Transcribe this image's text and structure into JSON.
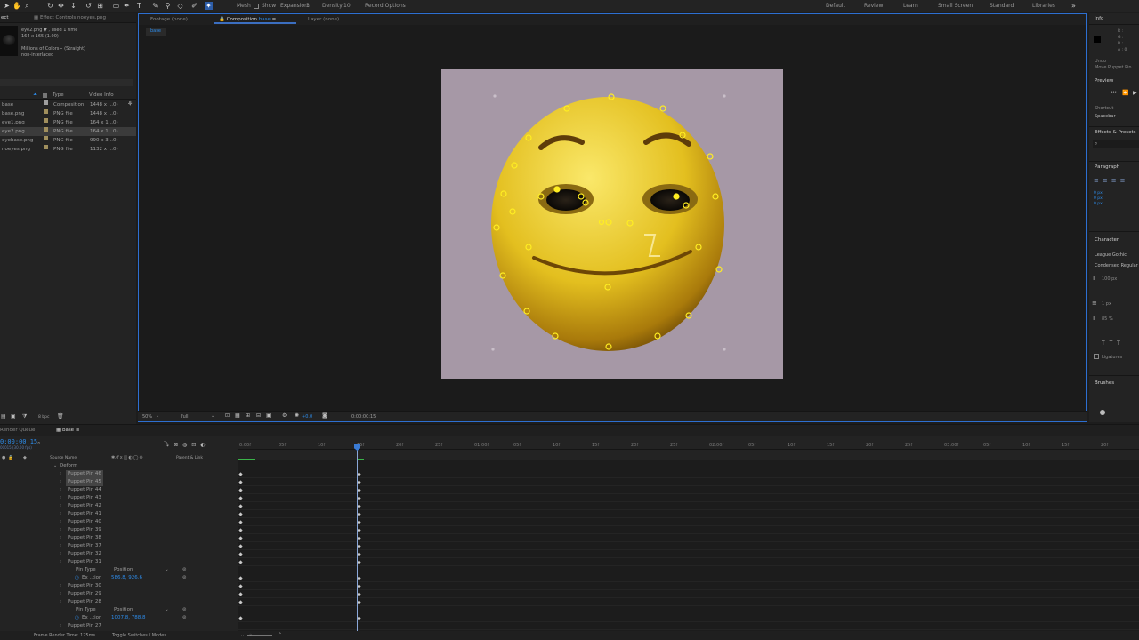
{
  "toolbar": {
    "mesh_label": "Mesh",
    "show_label": "Show",
    "expansion_label": "Expansion:",
    "expansion_value": "3",
    "density_label": "Density:",
    "density_value": "10",
    "record_options": "Record Options",
    "workspaces": [
      "Default",
      "Review",
      "Learn",
      "Small Screen",
      "Standard",
      "Libraries"
    ]
  },
  "project": {
    "tab_project": "ect",
    "tab_effect_controls": "Effect Controls noeyes.png",
    "preview_name": "eye2.png ▼ , used 1 time",
    "preview_dims": "164 x 165 (1.00)",
    "preview_color": "Millions of Colors+ (Straight)",
    "preview_interlace": "non-interlaced",
    "col_type": "Type",
    "col_info": "Video Info",
    "items": [
      {
        "name": "base",
        "type": "Composition",
        "info": "1448 x ...0)",
        "color": "#9e9e9e"
      },
      {
        "name": "base.png",
        "type": "PNG file",
        "info": "1448 x ...0)",
        "color": "#a08f5d"
      },
      {
        "name": "eye1.png",
        "type": "PNG file",
        "info": "164 x 1...0)",
        "color": "#a08f5d"
      },
      {
        "name": "eye2.png",
        "type": "PNG file",
        "info": "164 x 1...0)",
        "color": "#a08f5d"
      },
      {
        "name": "eyebase.png",
        "type": "PNG file",
        "info": "990 x 3...0)",
        "color": "#a08f5d"
      },
      {
        "name": "noeyes.png",
        "type": "PNG file",
        "info": "1132 x ...0)",
        "color": "#a08f5d"
      }
    ],
    "footer_bpc": "8 bpc"
  },
  "viewer": {
    "tab_footage": "Footage (none)",
    "tab_composition": "Composition",
    "tab_composition_name": "base",
    "tab_layer": "Layer (none)",
    "breadcrumb": "base",
    "zoom": "50%",
    "resolution": "Full",
    "exposure": "+0.0",
    "timecode": "0:00:00:15"
  },
  "right": {
    "info_title": "Info",
    "info_rgb": [
      "R :",
      "G :",
      "B :",
      "A : 0"
    ],
    "undo_label": "Undo",
    "undo_action": "Move Puppet Pin",
    "preview_title": "Preview",
    "shortcut_label": "Shortcut",
    "shortcut_value": "Spacebar",
    "effects_title": "Effects & Presets",
    "search_placeholder": "⌕",
    "paragraph_title": "Paragraph",
    "para_values": [
      "0 px",
      "0 px",
      "0 px"
    ],
    "character_title": "Character",
    "font_name": "League Gothic",
    "font_style": "Condensed Regular",
    "font_size": "100 px",
    "leading": "1 px",
    "tracking": "85 %",
    "ligatures": "Ligatures",
    "brushes_title": "Brushes"
  },
  "timeline": {
    "tab_render_queue": "Render Queue",
    "tab_comp": "base",
    "current_time": "0:00:00:15",
    "frame_label": "00015 (30.00 fps)",
    "col_source": "Source Name",
    "col_parent": "Parent & Link",
    "deform": "Deform",
    "layers": [
      {
        "name": "Puppet Pin 46",
        "sel": true
      },
      {
        "name": "Puppet Pin 45",
        "sel": true
      },
      {
        "name": "Puppet Pin 44",
        "sel": false
      },
      {
        "name": "Puppet Pin 43",
        "sel": false
      },
      {
        "name": "Puppet Pin 42",
        "sel": false
      },
      {
        "name": "Puppet Pin 41",
        "sel": false
      },
      {
        "name": "Puppet Pin 40",
        "sel": false
      },
      {
        "name": "Puppet Pin 39",
        "sel": false
      },
      {
        "name": "Puppet Pin 38",
        "sel": false
      },
      {
        "name": "Puppet Pin 37",
        "sel": false
      },
      {
        "name": "Puppet Pin 32",
        "sel": false
      },
      {
        "name": "Puppet Pin 31",
        "sel": false
      }
    ],
    "pin_type_label": "Pin Type",
    "pin_type_value": "Position",
    "position_label": "Ex   ..tion",
    "position_value_1": "586.8,  926.6",
    "layers_b": [
      "Puppet Pin 30",
      "Puppet Pin 29",
      "Puppet Pin 28"
    ],
    "position_value_2": "1007.8,  788.8",
    "layer_last": "Puppet Pin 27",
    "ruler": [
      "0:00f",
      "05f",
      "10f",
      "15f",
      "20f",
      "25f",
      "01:00f",
      "05f",
      "10f",
      "15f",
      "20f",
      "25f",
      "02:00f",
      "05f",
      "10f",
      "15f",
      "20f",
      "25f",
      "03:00f",
      "05f",
      "10f",
      "15f",
      "20f"
    ],
    "render_time": "Frame Render Time: 125ms",
    "toggle_switches": "Toggle Switches / Modes"
  }
}
